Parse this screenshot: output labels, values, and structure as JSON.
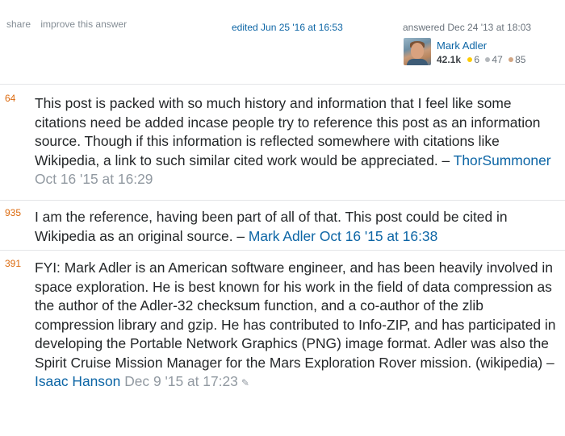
{
  "post_menu": {
    "share": "share",
    "improve": "improve this answer"
  },
  "edited": "edited Jun 25 '16 at 16:53",
  "answered": "answered Dec 24 '13 at 18:03",
  "user": {
    "name": "Mark Adler",
    "reputation": "42.1k",
    "gold": "6",
    "silver": "47",
    "bronze": "85"
  },
  "comments": [
    {
      "score": "64",
      "text": "This post is packed with so much history and information that I feel like some citations need be added incase people try to reference this post as an information source. Though if this information is reflected somewhere with citations like Wikipedia, a link to such similar cited work would be appreciated. – ",
      "user": "ThorSummoner",
      "date": "Oct 16 '15 at 16:29"
    },
    {
      "score": "935",
      "text": "I am the reference, having been part of all of that. This post could be cited in Wikipedia as an original source. – ",
      "user": "Mark Adler",
      "date": "Oct 16 '15 at 16:38"
    },
    {
      "score": "391",
      "text": "FYI: Mark Adler is an American software engineer, and has been heavily involved in space exploration. He is best known for his work in the field of data compression as the author of the Adler-32 checksum function, and a co-author of the zlib compression library and gzip. He has contributed to Info-ZIP, and has participated in developing the Portable Network Graphics (PNG) image format. Adler was also the Spirit Cruise Mission Manager for the Mars Exploration Rover mission. (wikipedia) – ",
      "user": "Isaac Hanson",
      "date": "Dec 9 '15 at 17:23"
    }
  ],
  "icons": {
    "edit": "pencil-icon"
  },
  "colors": {
    "link": "#0c65a5",
    "score": "#dc6a0e",
    "date": "#9199a1"
  }
}
